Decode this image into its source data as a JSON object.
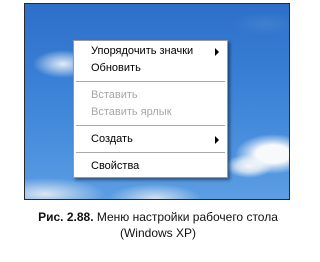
{
  "context_menu": {
    "arrange_icons": "Упорядочить значки",
    "refresh": "Обновить",
    "paste": "Вставить",
    "paste_shortcut": "Вставить ярлык",
    "new": "Создать",
    "properties": "Свойства"
  },
  "caption": {
    "label": "Рис. 2.88.",
    "text_line1": " Меню настройки рабочего стола",
    "text_line2": "(Windows XP)"
  },
  "icons": {
    "submenu_arrow": "chevron-right-icon"
  },
  "colors": {
    "desktop_blue": "#3a80d6",
    "menu_background": "#ffffff",
    "disabled_text": "#a6a6a6"
  }
}
